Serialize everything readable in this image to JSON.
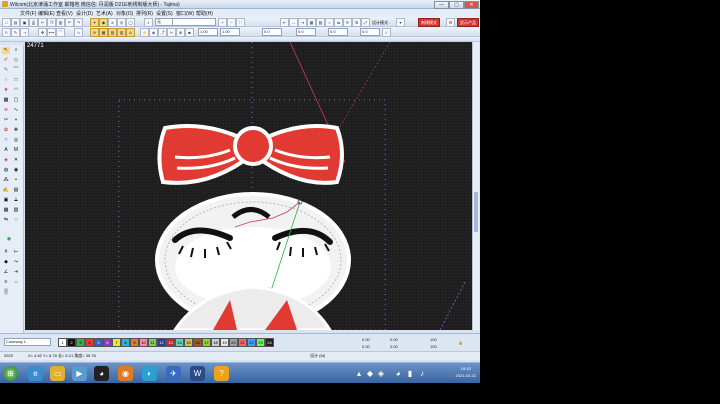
{
  "window": {
    "title": "Wilcom(北京津涌工作室 邮箱地 微信信: 丹润版 D21E刺绣制版大师) - Tajima)",
    "buttons": {
      "min": "—",
      "max": "▢",
      "close": "✕"
    }
  },
  "menu": [
    "文件(F)",
    "编辑(E)",
    "查看(V)",
    "设计(D)",
    "艺术(A)",
    "对象(O)",
    "排列(R)",
    "设置(S)",
    "窗口(W)",
    "帮助(H)"
  ],
  "toolbar": {
    "design_mode_label": "设计模式 :",
    "mode_button": "刺绣模式",
    "product_button": "显示产品",
    "fill_select": "无",
    "zoom_values": [
      "1.00",
      "1.00",
      "0.0",
      "0.0",
      "0.0",
      "0.0"
    ]
  },
  "canvas": {
    "stitch_count": "24771",
    "accent_red": "#e03a33",
    "bg": "#1c1c1c"
  },
  "bottom": {
    "colorway": "Colorway 1",
    "swatches": [
      {
        "n": "1",
        "c": "#ffffff"
      },
      {
        "n": "2",
        "c": "#111111"
      },
      {
        "n": "3",
        "c": "#2ab34a"
      },
      {
        "n": "4",
        "c": "#e33b2e"
      },
      {
        "n": "5",
        "c": "#2f5fd0"
      },
      {
        "n": "6",
        "c": "#8a3cc4"
      },
      {
        "n": "7",
        "c": "#f0e040"
      },
      {
        "n": "8",
        "c": "#2fb0e0"
      },
      {
        "n": "9",
        "c": "#e07a2a"
      },
      {
        "n": "10",
        "c": "#f08ab0"
      },
      {
        "n": "11",
        "c": "#7ad04a"
      },
      {
        "n": "12",
        "c": "#2f3a8a"
      },
      {
        "n": "13",
        "c": "#c42a2a"
      },
      {
        "n": "14",
        "c": "#5ad0c0"
      },
      {
        "n": "15",
        "c": "#d0c050"
      },
      {
        "n": "16",
        "c": "#a05a2a"
      },
      {
        "n": "17",
        "c": "#9acd32"
      },
      {
        "n": "18",
        "c": "#cccccc"
      },
      {
        "n": "19",
        "c": "#e8e8e8"
      },
      {
        "n": "20",
        "c": "#a0a0a0"
      },
      {
        "n": "21",
        "c": "#ff6060"
      },
      {
        "n": "22",
        "c": "#40a0ff"
      },
      {
        "n": "23",
        "c": "#60ff60"
      },
      {
        "n": "24",
        "c": "#202020"
      }
    ],
    "coords": {
      "w1": "0.00",
      "w2": "0.00",
      "h1": "0.00",
      "h2": "0.00",
      "pct1": "100",
      "pct2": "100",
      "lock": "🔒"
    }
  },
  "status": {
    "left": "2923",
    "xy": "X= 4.62 Y= 6.78 长= 8.21 角度= 35.78",
    "right": "设计 (M)"
  },
  "taskbar": {
    "clock_time": "19:15",
    "clock_date": "2021-03-22"
  }
}
